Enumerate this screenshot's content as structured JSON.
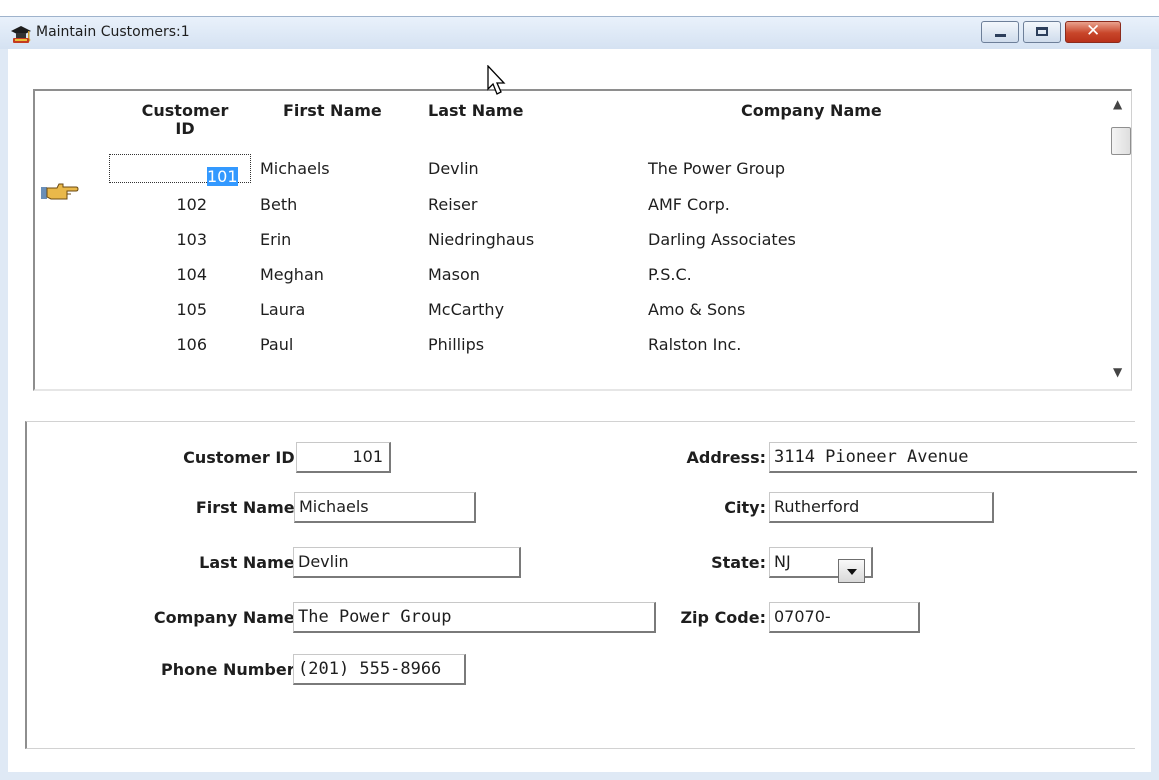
{
  "window": {
    "title": "Maintain Customers:1",
    "icon": "graduation-cap-app-icon",
    "buttons": [
      "minimize",
      "maximize",
      "close"
    ]
  },
  "grid": {
    "headers": {
      "customer_id": "Customer\nID",
      "first_name": "First Name",
      "last_name": "Last Name",
      "company_name": "Company Name"
    },
    "rows": [
      {
        "id": "101",
        "first": "Michaels",
        "last": "Devlin",
        "company": "The Power Group"
      },
      {
        "id": "102",
        "first": "Beth",
        "last": "Reiser",
        "company": "AMF Corp."
      },
      {
        "id": "103",
        "first": "Erin",
        "last": "Niedringhaus",
        "company": "Darling Associates"
      },
      {
        "id": "104",
        "first": "Meghan",
        "last": "Mason",
        "company": "P.S.C."
      },
      {
        "id": "105",
        "first": "Laura",
        "last": "McCarthy",
        "company": "Amo & Sons"
      },
      {
        "id": "106",
        "first": "Paul",
        "last": "Phillips",
        "company": "Ralston Inc."
      }
    ],
    "selected_row": 0,
    "pointer_icon": "hand-pointer-icon"
  },
  "form": {
    "labels": {
      "customer_id": "Customer ID:",
      "first_name": "First Name:",
      "last_name": "Last Name:",
      "company_name": "Company Name:",
      "phone_number": "Phone Number:",
      "address": "Address:",
      "city": "City:",
      "state": "State:",
      "zip_code": "Zip Code:"
    },
    "values": {
      "customer_id": "101",
      "first_name": "Michaels",
      "last_name": "Devlin",
      "company_name": "The Power Group",
      "phone_number": "(201) 555-8966",
      "address": "3114 Pioneer Avenue",
      "city": "Rutherford",
      "state": "NJ",
      "zip_code": "07070-"
    }
  },
  "colors": {
    "selection": "#3399ff",
    "window_frame": "#dfe9f5",
    "close_button": "#c8462a"
  }
}
